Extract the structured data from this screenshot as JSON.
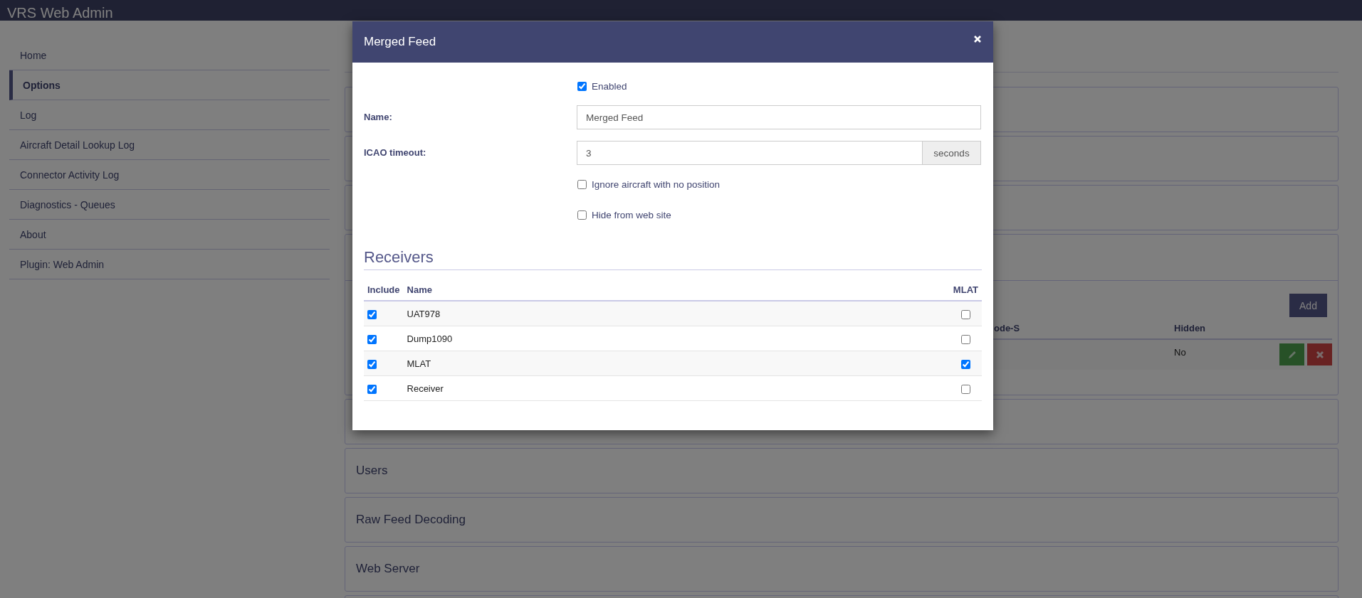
{
  "header": {
    "title": "VRS Web Admin"
  },
  "sidebar": {
    "items": [
      {
        "label": "Home",
        "selected": false
      },
      {
        "label": "Options",
        "selected": true
      },
      {
        "label": "Log",
        "selected": false
      },
      {
        "label": "Aircraft Detail Lookup Log",
        "selected": false
      },
      {
        "label": "Connector Activity Log",
        "selected": false
      },
      {
        "label": "Diagnostics - Queues",
        "selected": false
      },
      {
        "label": "About",
        "selected": false
      },
      {
        "label": "Plugin: Web Admin",
        "selected": false
      }
    ]
  },
  "panels": [
    {
      "kind": "collapsed"
    },
    {
      "kind": "collapsed"
    },
    {
      "kind": "collapsed"
    },
    {
      "kind": "expanded",
      "add_button": "Add",
      "columns": [
        "ode-S",
        "Hidden"
      ],
      "rows": [
        {
          "hidden": "No"
        }
      ]
    },
    {
      "kind": "collapsed"
    },
    {
      "kind": "collapsed",
      "title": "Users"
    },
    {
      "kind": "collapsed",
      "title": "Raw Feed Decoding"
    },
    {
      "kind": "collapsed",
      "title": "Web Server"
    },
    {
      "kind": "collapsed"
    }
  ],
  "modal": {
    "title": "Merged Feed",
    "form": [
      {
        "kind": "checkbox",
        "label": "Enabled",
        "checked": true
      },
      {
        "kind": "text",
        "label": "Name:",
        "value": "Merged Feed"
      },
      {
        "kind": "addon",
        "label": "ICAO timeout:",
        "value": "3",
        "addon": "seconds"
      },
      {
        "kind": "checkbox",
        "label": "Ignore aircraft with no position",
        "checked": false
      },
      {
        "kind": "checkbox",
        "label": "Hide from web site",
        "checked": false
      }
    ],
    "receivers": {
      "heading": "Receivers",
      "columns": [
        "Include",
        "Name",
        "MLAT"
      ],
      "rows": [
        {
          "include": true,
          "name": "UAT978",
          "mlat": false
        },
        {
          "include": true,
          "name": "Dump1090",
          "mlat": false
        },
        {
          "include": true,
          "name": "MLAT",
          "mlat": true
        },
        {
          "include": true,
          "name": "Receiver",
          "mlat": false
        }
      ]
    }
  }
}
